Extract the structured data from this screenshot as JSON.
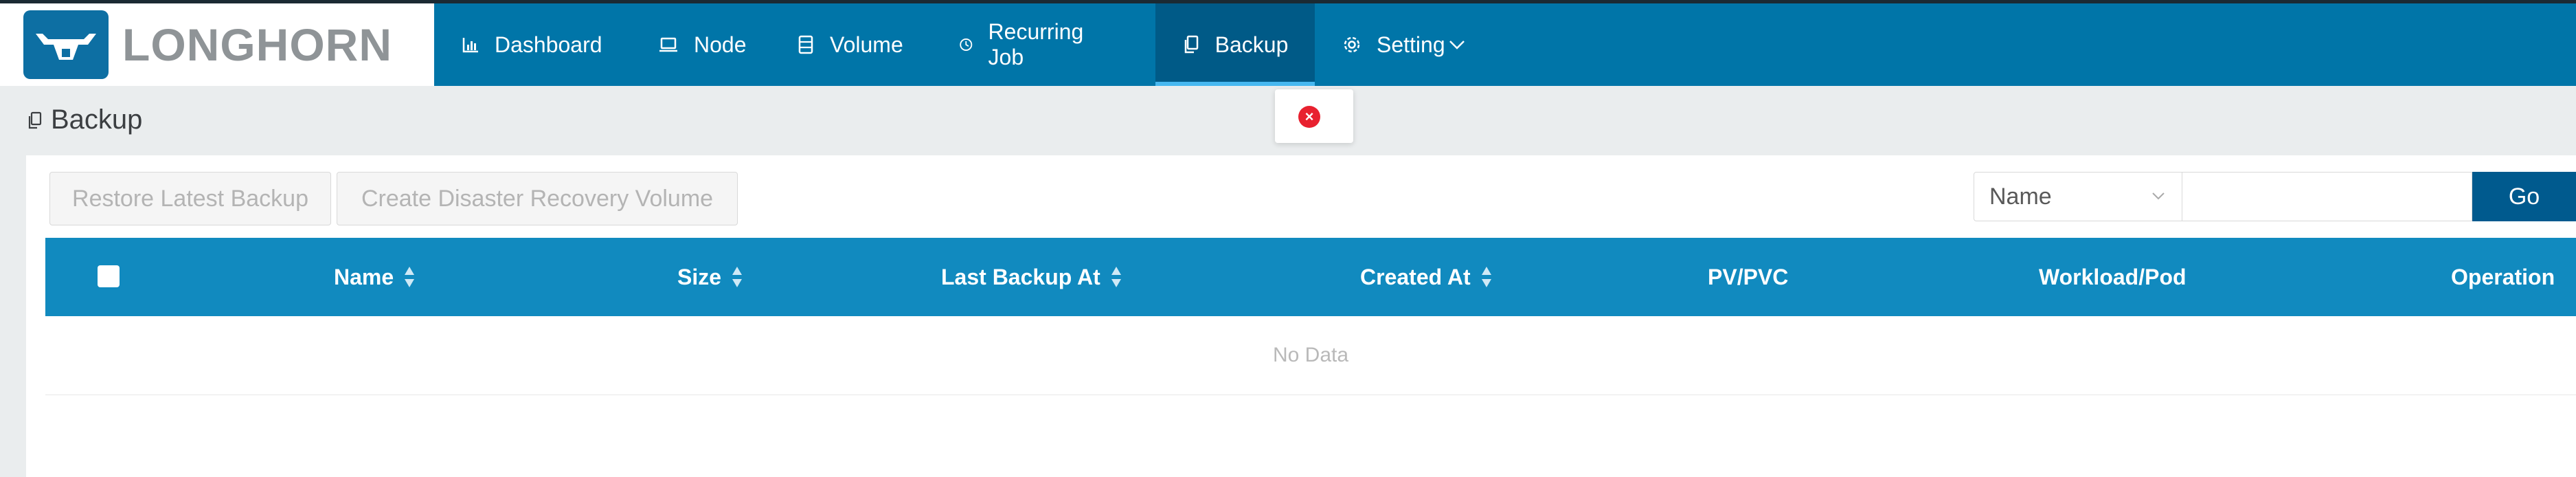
{
  "app": {
    "logo_text": "LONGHORN",
    "colors": {
      "header": "#0075a8",
      "active_nav": "#005a87",
      "table_header": "#118abf",
      "go_button": "#005a8e",
      "error": "#e8212f"
    }
  },
  "nav": {
    "items": [
      {
        "label": "Dashboard",
        "icon": "bar-chart-icon"
      },
      {
        "label": "Node",
        "icon": "laptop-icon"
      },
      {
        "label": "Volume",
        "icon": "database-icon"
      },
      {
        "label": "Recurring Job",
        "icon": "clock-icon"
      },
      {
        "label": "Backup",
        "icon": "copy-icon",
        "active": true
      },
      {
        "label": "Setting",
        "icon": "gear-icon",
        "suffix_icon": "chevron-down-icon"
      }
    ]
  },
  "toast": {
    "icon": "error-circle-icon",
    "glyph": "×"
  },
  "page": {
    "title": "Backup",
    "title_icon": "copy-icon"
  },
  "toolbar": {
    "restore_label": "Restore Latest Backup",
    "create_dr_label": "Create Disaster Recovery Volume",
    "search_field_value": "Name",
    "search_value": "",
    "go_label": "Go"
  },
  "table": {
    "columns": [
      "Name",
      "Size",
      "Last Backup At",
      "Created At",
      "PV/PVC",
      "Workload/Pod",
      "Operation"
    ],
    "sortable": [
      true,
      true,
      true,
      true,
      false,
      false,
      false
    ],
    "empty_text": "No Data"
  }
}
